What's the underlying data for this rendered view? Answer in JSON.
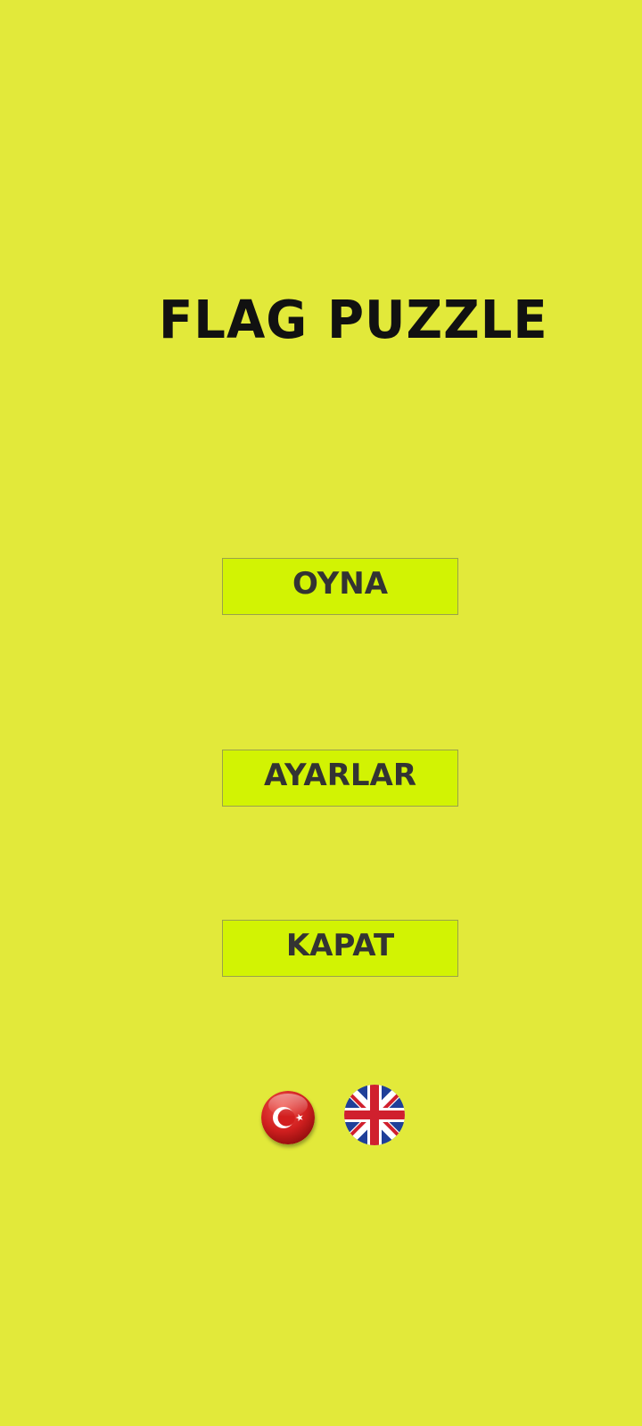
{
  "title": {
    "word1": "FLAG",
    "word2": "PUZZLE"
  },
  "menu": {
    "play_label": "OYNA",
    "settings_label": "AYARLAR",
    "quit_label": "KAPAT"
  },
  "languages": [
    {
      "code": "tr",
      "icon": "turkey-flag-icon"
    },
    {
      "code": "en",
      "icon": "uk-flag-icon"
    }
  ],
  "colors": {
    "background": "#e2e93a",
    "button": "#d2f303",
    "button_text": "#333333",
    "title_text": "#111111"
  }
}
